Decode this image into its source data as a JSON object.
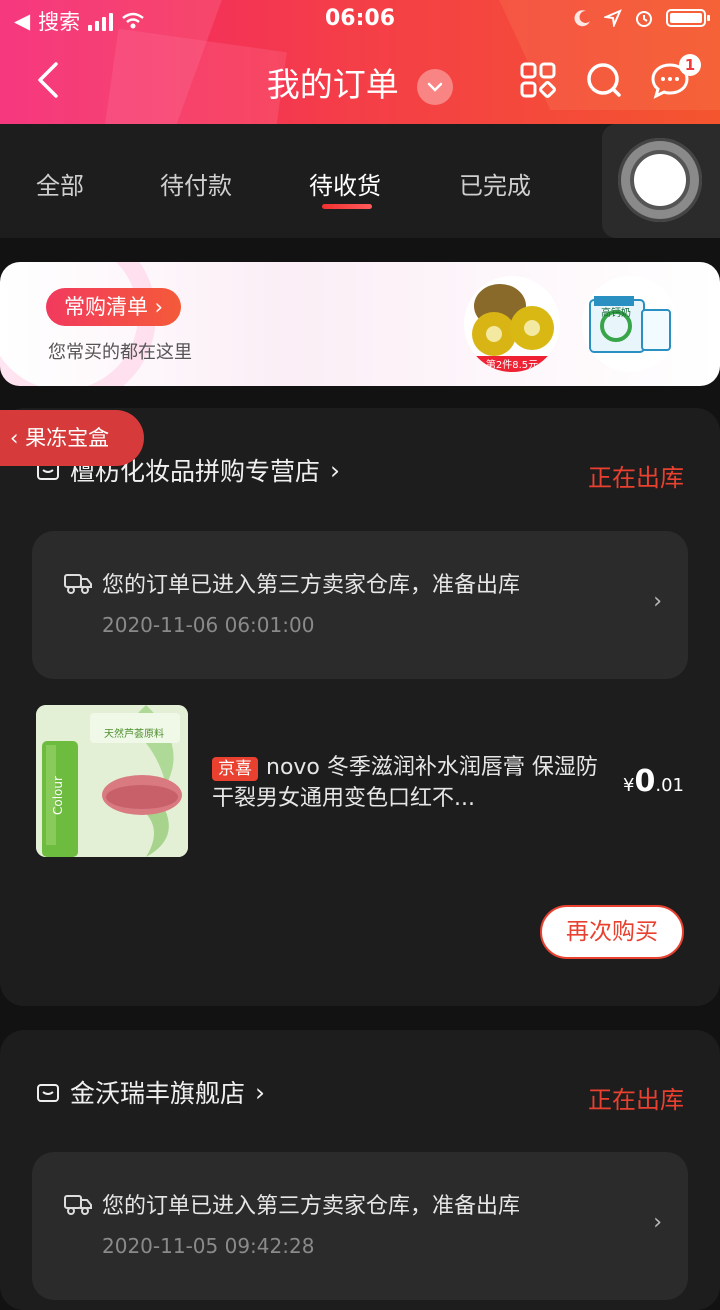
{
  "status_bar": {
    "carrier": "搜索",
    "time": "06:06"
  },
  "header": {
    "title": "我的订单",
    "message_badge": "1"
  },
  "tabs": [
    "全部",
    "待付款",
    "待收货",
    "已完成"
  ],
  "active_tab": "待收货",
  "promo": {
    "pill_label": "常购清单",
    "subtitle": "您常买的都在这里",
    "product1_caption": "第2件8.5元",
    "product2_caption": "高钙奶"
  },
  "side_tag": "果冻宝盒",
  "orders": [
    {
      "store": "檀枋化妆品拼购专营店",
      "status": "正在出库",
      "tracking_text": "您的订单已进入第三方卖家仓库，准备出库",
      "tracking_time": "2020-11-06 06:01:00",
      "tag": "京喜",
      "product_name": "novo 冬季滋润补水润唇膏 保湿防干裂男女通用变色口红不...",
      "price_symbol": "¥",
      "price_int": "0",
      "price_dec": ".01",
      "rebuy_label": "再次购买",
      "thumb_text1": "天然芦荟原料",
      "thumb_text2": "Colour"
    },
    {
      "store": "金沃瑞丰旗舰店",
      "status": "正在出库",
      "tracking_text": "您的订单已进入第三方卖家仓库，准备出库",
      "tracking_time": "2020-11-05 09:42:28"
    }
  ],
  "colors": {
    "accent": "#e9402f",
    "header_start": "#f5216f",
    "header_end": "#f4552e"
  }
}
